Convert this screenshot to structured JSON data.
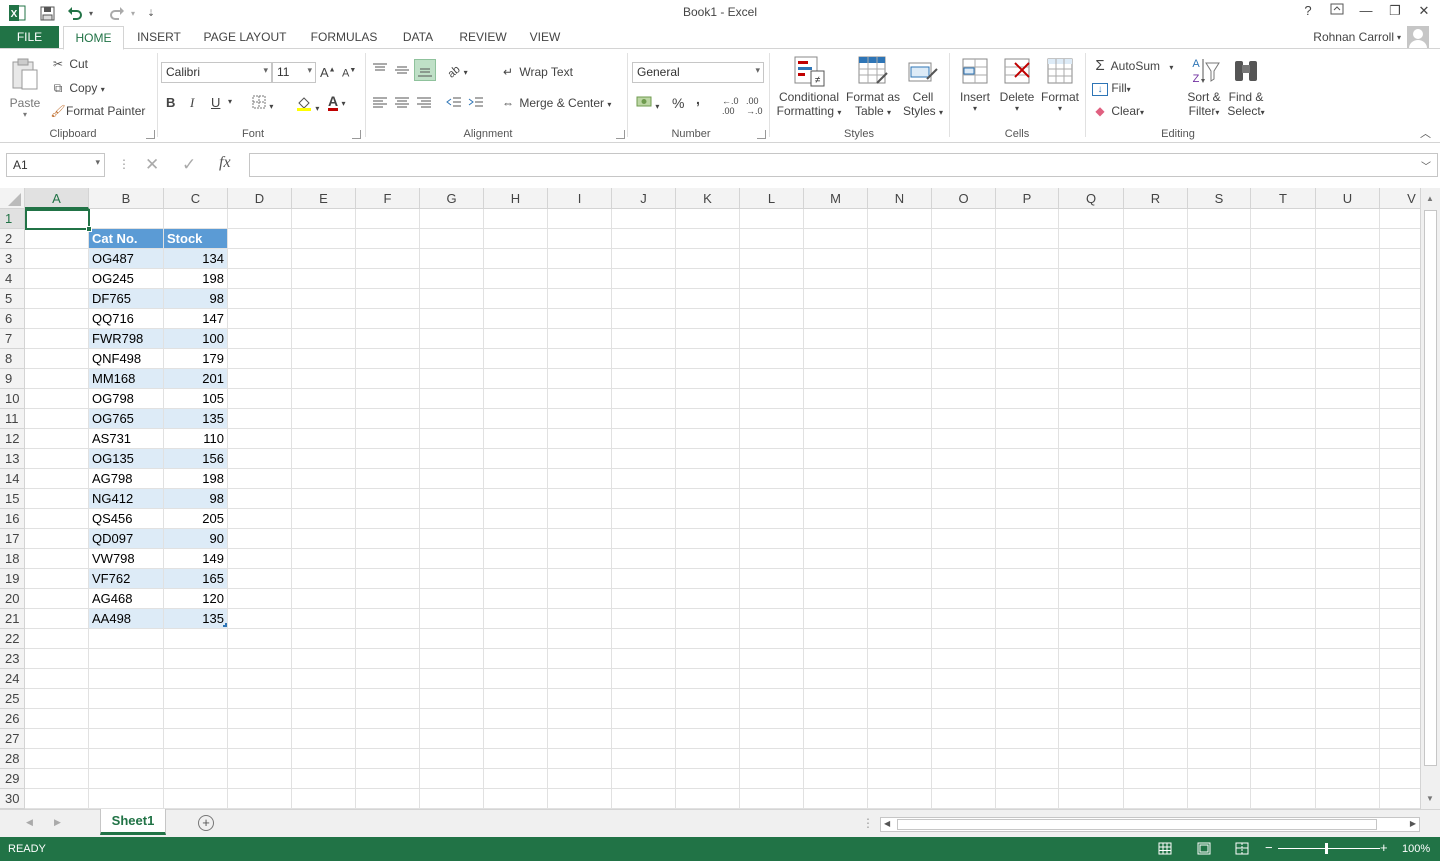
{
  "titlebar": {
    "title": "Book1 - Excel",
    "help": "?",
    "ribbon_display": "⊡",
    "minimize": "—",
    "restore": "❐",
    "close": "✕"
  },
  "tabs": {
    "file": "FILE",
    "home": "HOME",
    "insert": "INSERT",
    "page_layout": "PAGE LAYOUT",
    "formulas": "FORMULAS",
    "data": "DATA",
    "review": "REVIEW",
    "view": "VIEW",
    "user": "Rohnan Carroll"
  },
  "ribbon": {
    "clipboard": {
      "paste": "Paste",
      "cut": "Cut",
      "copy": "Copy",
      "format_painter": "Format Painter",
      "label": "Clipboard"
    },
    "font": {
      "name": "Calibri",
      "size": "11",
      "label": "Font",
      "bold": "B",
      "italic": "I",
      "underline": "U"
    },
    "alignment": {
      "wrap_text": "Wrap Text",
      "merge_center": "Merge & Center",
      "label": "Alignment"
    },
    "number": {
      "format": "General",
      "percent": "%",
      "comma": ",",
      "label": "Number"
    },
    "styles": {
      "conditional_1": "Conditional",
      "conditional_2": "Formatting",
      "format_table_1": "Format as",
      "format_table_2": "Table",
      "cell_styles_1": "Cell",
      "cell_styles_2": "Styles",
      "label": "Styles"
    },
    "cells": {
      "insert": "Insert",
      "delete": "Delete",
      "format": "Format",
      "label": "Cells"
    },
    "editing": {
      "autosum": "AutoSum",
      "fill": "Fill",
      "clear": "Clear",
      "sort_1": "Sort &",
      "sort_2": "Filter",
      "find_1": "Find &",
      "find_2": "Select",
      "label": "Editing"
    }
  },
  "formula_bar": {
    "name_box": "A1",
    "fx": "fx",
    "value": ""
  },
  "columns": [
    "A",
    "B",
    "C",
    "D",
    "E",
    "F",
    "G",
    "H",
    "I",
    "J",
    "K",
    "L",
    "M",
    "N",
    "O",
    "P",
    "Q",
    "R",
    "S",
    "T",
    "U",
    "V"
  ],
  "rows": [
    "1",
    "2",
    "3",
    "4",
    "5",
    "6",
    "7",
    "8",
    "9",
    "10",
    "11",
    "12",
    "13",
    "14",
    "15",
    "16",
    "17",
    "18",
    "19",
    "20",
    "21",
    "22",
    "23",
    "24",
    "25",
    "26",
    "27",
    "28",
    "29",
    "30"
  ],
  "table": {
    "headers": [
      "Cat No.",
      "Stock"
    ],
    "rows": [
      [
        "OG487",
        "134"
      ],
      [
        "OG245",
        "198"
      ],
      [
        "DF765",
        "98"
      ],
      [
        "QQ716",
        "147"
      ],
      [
        "FWR798",
        "100"
      ],
      [
        "QNF498",
        "179"
      ],
      [
        "MM168",
        "201"
      ],
      [
        "OG798",
        "105"
      ],
      [
        "OG765",
        "135"
      ],
      [
        "AS731",
        "110"
      ],
      [
        "OG135",
        "156"
      ],
      [
        "AG798",
        "198"
      ],
      [
        "NG412",
        "98"
      ],
      [
        "QS456",
        "205"
      ],
      [
        "QD097",
        "90"
      ],
      [
        "VW798",
        "149"
      ],
      [
        "VF762",
        "165"
      ],
      [
        "AG468",
        "120"
      ],
      [
        "AA498",
        "135"
      ]
    ]
  },
  "sheets": {
    "active": "Sheet1"
  },
  "status": {
    "mode": "READY",
    "zoom": "100%"
  },
  "colors": {
    "accent": "#217346",
    "table_header": "#5b9bd5",
    "table_band": "#ddebf7"
  }
}
